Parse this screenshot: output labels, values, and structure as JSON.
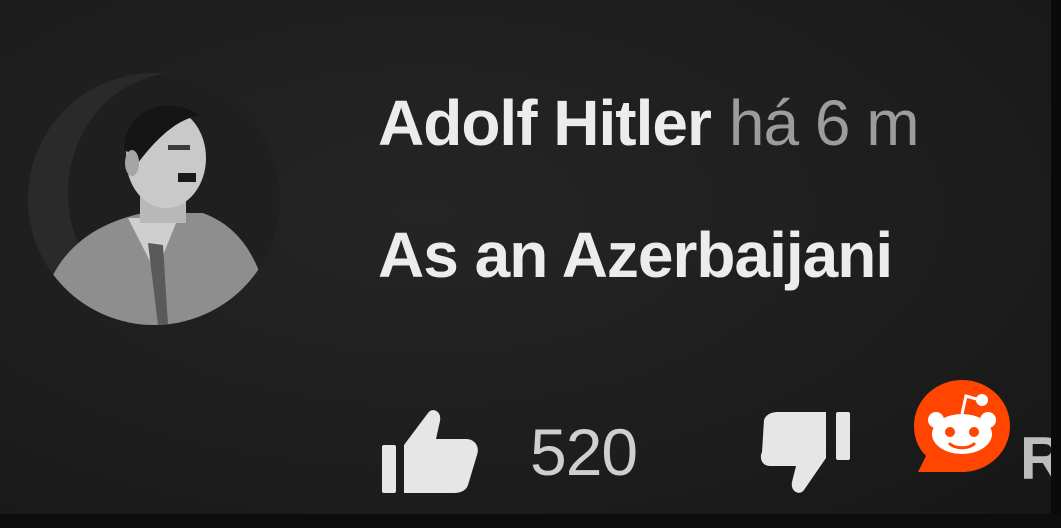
{
  "comment": {
    "author": "Adolf Hitler",
    "timestamp": "há 6 m",
    "text": "As an Azerbaijani",
    "likes": "520",
    "reply_label": "R"
  },
  "icons": {
    "like": "thumbs-up-icon",
    "dislike": "thumbs-down-icon",
    "watermark": "reddit-logo-icon",
    "avatar": "profile-photo"
  },
  "colors": {
    "background": "#1d1d1d",
    "text_primary": "#ececec",
    "text_secondary": "#9c9c9c",
    "reddit_orange": "#ff4500"
  }
}
